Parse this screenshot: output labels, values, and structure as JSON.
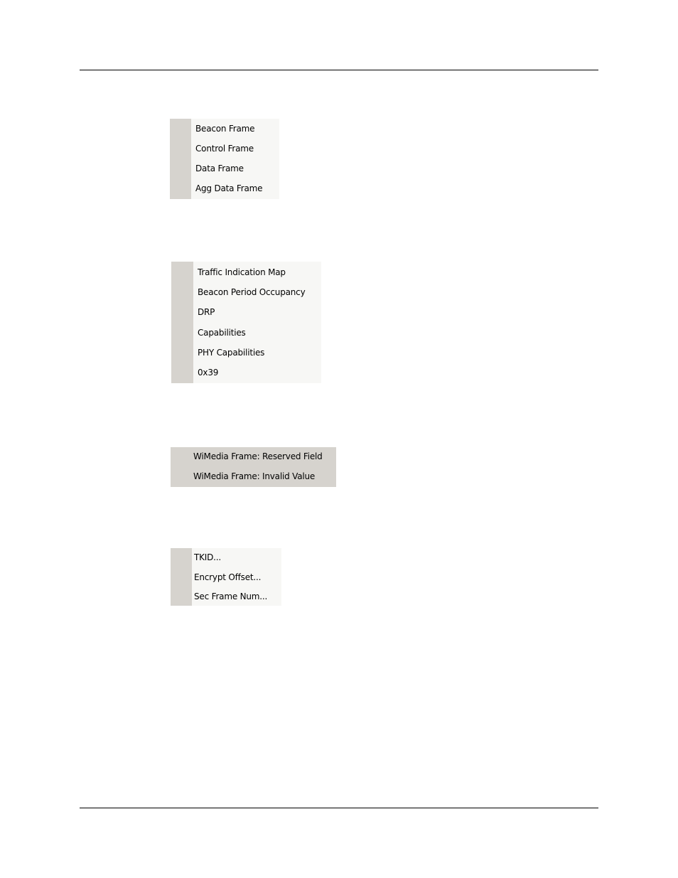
{
  "menus": {
    "frame_types": {
      "items": [
        {
          "label": "Beacon Frame"
        },
        {
          "label": "Control Frame"
        },
        {
          "label": "Data Frame"
        },
        {
          "label": "Agg Data Frame"
        }
      ]
    },
    "ie_types": {
      "items": [
        {
          "label": "Traffic Indication Map"
        },
        {
          "label": "Beacon Period Occupancy"
        },
        {
          "label": "DRP"
        },
        {
          "label": "Capabilities"
        },
        {
          "label": "PHY Capabilities"
        },
        {
          "label": "0x39"
        }
      ]
    },
    "errors": {
      "items": [
        {
          "label": "WiMedia Frame: Reserved Field"
        },
        {
          "label": "WiMedia Frame: Invalid Value"
        }
      ]
    },
    "security": {
      "items": [
        {
          "label": "TKID..."
        },
        {
          "label": "Encrypt Offset..."
        },
        {
          "label": "Sec Frame Num..."
        }
      ]
    }
  }
}
